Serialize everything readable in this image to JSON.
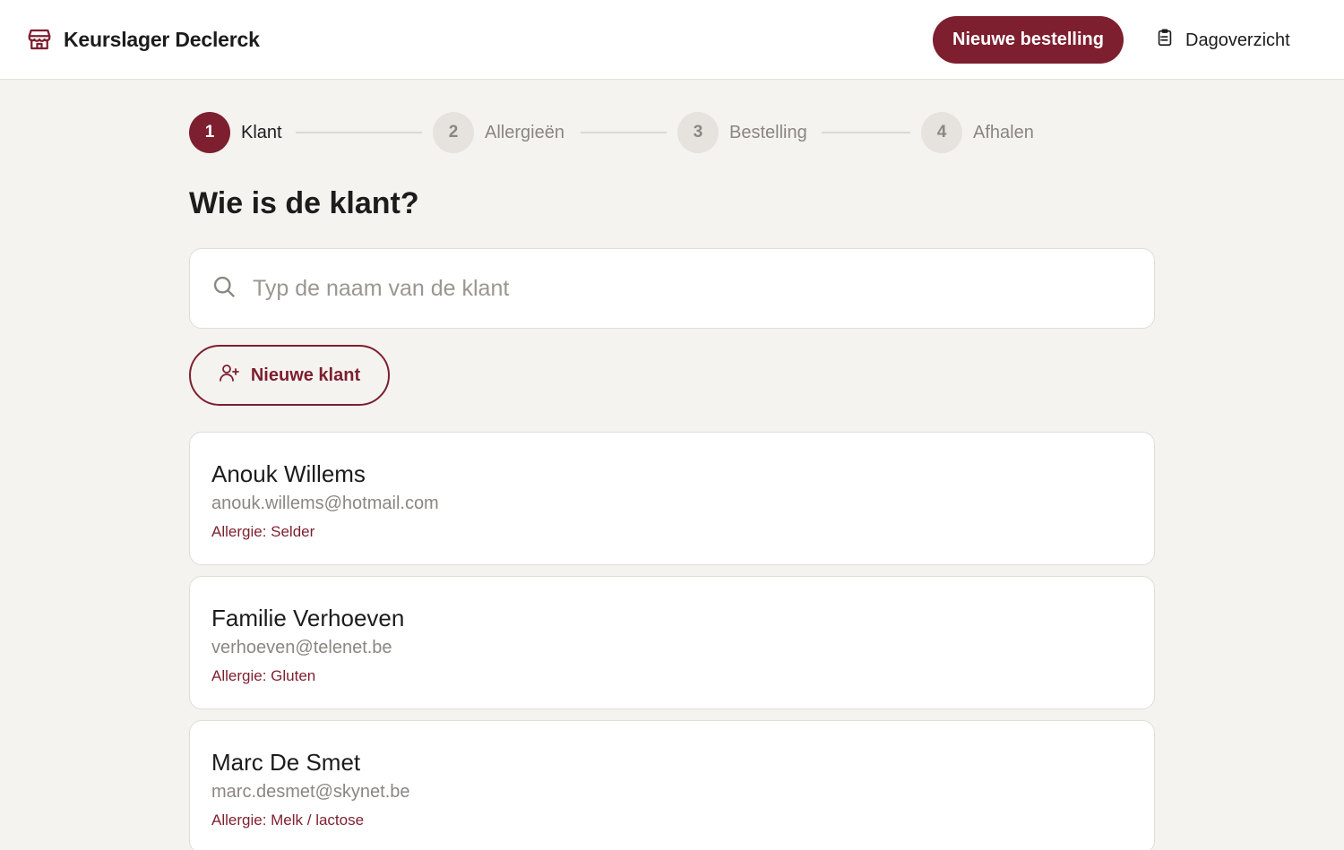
{
  "header": {
    "brand": "Keurslager Declerck",
    "brand_icon": "store-icon",
    "primary_button": "Nieuwe bestelling",
    "nav_link": "Dagoverzicht",
    "nav_icon": "clipboard-list-icon",
    "accent_color": "#7d1f2e"
  },
  "stepper": {
    "steps": [
      {
        "number": "1",
        "label": "Klant",
        "active": true
      },
      {
        "number": "2",
        "label": "Allergieën",
        "active": false
      },
      {
        "number": "3",
        "label": "Bestelling",
        "active": false
      },
      {
        "number": "4",
        "label": "Afhalen",
        "active": false
      }
    ]
  },
  "main": {
    "title": "Wie is de klant?",
    "search": {
      "placeholder": "Typ de naam van de klant",
      "value": "",
      "icon": "search-icon"
    },
    "new_customer_button": "Nieuwe klant",
    "new_customer_icon": "user-plus-icon"
  },
  "customers": [
    {
      "name": "Anouk Willems",
      "email": "anouk.willems@hotmail.com",
      "allergy": "Allergie: Selder"
    },
    {
      "name": "Familie Verhoeven",
      "email": "verhoeven@telenet.be",
      "allergy": "Allergie: Gluten"
    },
    {
      "name": "Marc De Smet",
      "email": "marc.desmet@skynet.be",
      "allergy": "Allergie: Melk / lactose"
    }
  ]
}
